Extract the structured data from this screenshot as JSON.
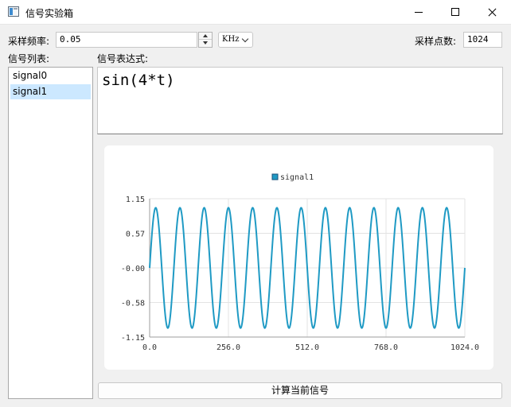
{
  "window": {
    "title": "信号实验箱"
  },
  "sampling": {
    "freq_label": "采样频率:",
    "freq_value": "0.05",
    "unit": "KHz",
    "points_label": "采样点数:",
    "points_value": "1024"
  },
  "signal_list": {
    "label": "信号列表:",
    "items": [
      {
        "label": "signal0",
        "selected": false
      },
      {
        "label": "signal1",
        "selected": true
      }
    ]
  },
  "expression": {
    "label": "信号表达式:",
    "value": "sin(4*t)"
  },
  "action_button": "计算当前信号",
  "colors": {
    "accent": "#1f9ac4",
    "selection": "#cce8ff"
  },
  "chart_data": {
    "type": "line",
    "title": "",
    "xlabel": "",
    "ylabel": "",
    "xlim": [
      0,
      1024
    ],
    "ylim": [
      -1.15,
      1.15
    ],
    "x_ticks": [
      "0.0",
      "256.0",
      "512.0",
      "768.0",
      "1024.0"
    ],
    "y_ticks": [
      "1.15",
      "0.57",
      "-0.00",
      "-0.58",
      "-1.15"
    ],
    "grid": true,
    "legend": "top-center",
    "series": [
      {
        "name": "signal1",
        "color": "#1f9ac4",
        "expression": "sin(4*t)",
        "sample_rate_khz": 0.05,
        "samples": 1024,
        "cycles_shown": 13
      }
    ]
  }
}
